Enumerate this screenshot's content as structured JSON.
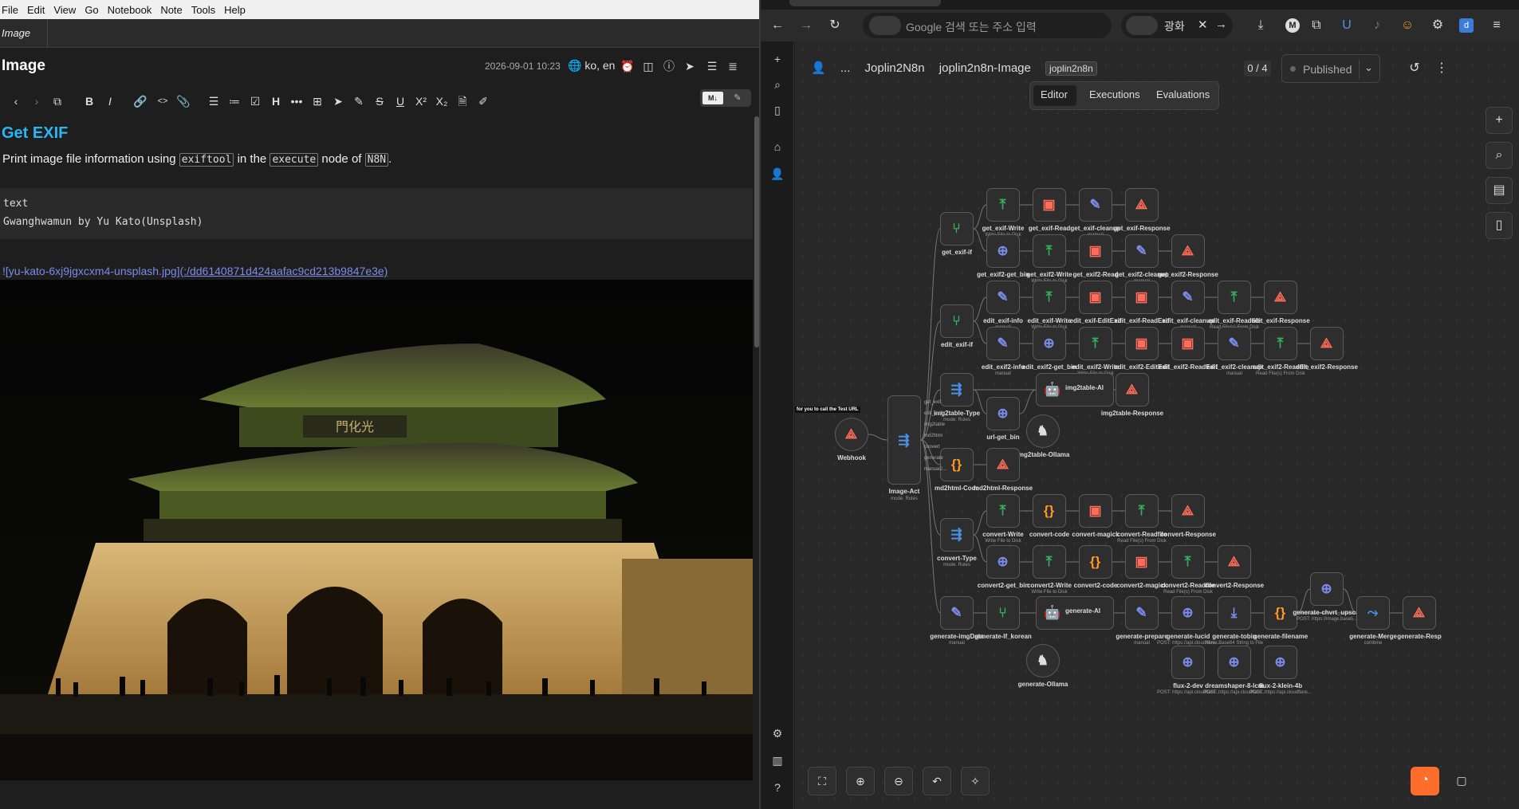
{
  "joplin": {
    "menu": [
      "File",
      "Edit",
      "View",
      "Go",
      "Notebook",
      "Note",
      "Tools",
      "Help"
    ],
    "tab_title": "Image",
    "note_title": "Image",
    "note_date": "2026-09-01 10:23",
    "note_lang": "ko, en",
    "md_toggle_label": "M↓",
    "heading": "Get EXIF",
    "para_prefix": "Print image file information using ",
    "code1": "exiftool",
    "para_mid": " in the ",
    "code2": "execute",
    "para_mid2": " node of ",
    "code3": "N8N",
    "para_end": ".",
    "code_block": "text\nGwanghwamun by Yu Kato(Unsplash)",
    "link_text": "![yu-kato-6xj9jgxcxm4-unsplash.jpg]",
    "link_url": "(:/dd6140871d424aafac9cd213b9847e3e)"
  },
  "browser": {
    "url_placeholder": "Google 검색 또는 주소 입력",
    "search_query": "광화",
    "breadcrumb": [
      "...",
      "Joplin2N8n",
      "joplin2n8n-Image"
    ],
    "tag": "joplin2n8n",
    "counter": "0 / 4",
    "published": "Published",
    "tabs": [
      "Editor",
      "Executions",
      "Evaluations"
    ]
  },
  "workflow": {
    "nodes": [
      {
        "id": "webhook",
        "label": "Webhook",
        "sub": "",
        "icon": "webhook-icon",
        "color": "#ff6d5a"
      },
      {
        "id": "image-act",
        "label": "Image-Act",
        "sub": "mode: Rules",
        "icon": "switch-icon",
        "color": "#4a90e2"
      },
      {
        "id": "get-exif-if",
        "label": "get_exif-if",
        "sub": "",
        "icon": "if-icon",
        "color": "#35b05c"
      },
      {
        "id": "get-exif-write",
        "label": "get_exif-Write",
        "sub": "Write File to Disk",
        "icon": "disk-icon",
        "color": "#35b05c"
      },
      {
        "id": "get-exif-read",
        "label": "get_exif-Read",
        "sub": "",
        "icon": "terminal-icon",
        "color": "#ff6d5a"
      },
      {
        "id": "get-exif-cleanup",
        "label": "get_exif-cleanup",
        "sub": "manual",
        "icon": "edit-icon",
        "color": "#7b8be8"
      },
      {
        "id": "get-exif-response",
        "label": "get_exif-Response",
        "sub": "",
        "icon": "webhook-icon",
        "color": "#ff6d5a"
      },
      {
        "id": "get-exif2-get-bin",
        "label": "get_exif2-get_bin",
        "sub": "",
        "icon": "globe-icon",
        "color": "#7b8be8"
      },
      {
        "id": "get-exif2-write",
        "label": "get_exif2-Write",
        "sub": "Write File to Disk",
        "icon": "disk-icon",
        "color": "#35b05c"
      },
      {
        "id": "get-exif2-read",
        "label": "get_exif2-Read",
        "sub": "",
        "icon": "terminal-icon",
        "color": "#ff6d5a"
      },
      {
        "id": "get-exif2-cleanup",
        "label": "get_exif2-cleanup",
        "sub": "manual",
        "icon": "edit-icon",
        "color": "#7b8be8"
      },
      {
        "id": "get-exif2-response",
        "label": "get_exif2-Response",
        "sub": "",
        "icon": "webhook-icon",
        "color": "#ff6d5a"
      },
      {
        "id": "edit-exif-if",
        "label": "edit_exif-if",
        "sub": "",
        "icon": "if-icon",
        "color": "#35b05c"
      },
      {
        "id": "edit-exif-info",
        "label": "edit_exif-info",
        "sub": "manual",
        "icon": "edit-icon",
        "color": "#7b8be8"
      },
      {
        "id": "edit-exif-write",
        "label": "edit_exif-Write",
        "sub": "Write File to Disk",
        "icon": "disk-icon",
        "color": "#35b05c"
      },
      {
        "id": "edit-exif-editexif",
        "label": "edit_exif-EditExif",
        "sub": "",
        "icon": "terminal-icon",
        "color": "#ff6d5a"
      },
      {
        "id": "edit-exif-readexif",
        "label": "edit_exif-ReadExif",
        "sub": "",
        "icon": "terminal-icon",
        "color": "#ff6d5a"
      },
      {
        "id": "edit-exif-cleanup",
        "label": "edit_exif-cleanup",
        "sub": "manual",
        "icon": "edit-icon",
        "color": "#7b8be8"
      },
      {
        "id": "edit-exif-readfile",
        "label": "edit_exif-Readfile",
        "sub": "Read File(s) From Disk",
        "icon": "disk-icon",
        "color": "#35b05c"
      },
      {
        "id": "edit-exif-response",
        "label": "edit_exif-Response",
        "sub": "",
        "icon": "webhook-icon",
        "color": "#ff6d5a"
      },
      {
        "id": "edit-exif2-info",
        "label": "edit_exif2-info",
        "sub": "manual",
        "icon": "edit-icon",
        "color": "#7b8be8"
      },
      {
        "id": "edit-exif2-get-bin",
        "label": "edit_exif2-get_bin",
        "sub": "",
        "icon": "globe-icon",
        "color": "#7b8be8"
      },
      {
        "id": "edit-exif2-write",
        "label": "edit_exif2-Write",
        "sub": "Write File to Disk",
        "icon": "disk-icon",
        "color": "#35b05c"
      },
      {
        "id": "edit-exif2-editexif",
        "label": "edit_exif2-EditExif",
        "sub": "",
        "icon": "terminal-icon",
        "color": "#ff6d5a"
      },
      {
        "id": "edit-exif2-readexif",
        "label": "edit_exif2-ReadExif",
        "sub": "",
        "icon": "terminal-icon",
        "color": "#ff6d5a"
      },
      {
        "id": "edit-exif2-cleanup",
        "label": "edit_exif2-cleanup",
        "sub": "manual",
        "icon": "edit-icon",
        "color": "#7b8be8"
      },
      {
        "id": "edit-exif2-readfile",
        "label": "edit_exif2-Readfile",
        "sub": "Read File(s) From Disk",
        "icon": "disk-icon",
        "color": "#35b05c"
      },
      {
        "id": "edit-exif2-response",
        "label": "edit_exif2-Response",
        "sub": "",
        "icon": "webhook-icon",
        "color": "#ff6d5a"
      },
      {
        "id": "img2table-type",
        "label": "img2table-Type",
        "sub": "mode: Rules",
        "icon": "switch-icon",
        "color": "#4a90e2"
      },
      {
        "id": "url-get-bin",
        "label": "url-get_bin",
        "sub": "",
        "icon": "globe-icon",
        "color": "#7b8be8"
      },
      {
        "id": "img2table-ai",
        "label": "img2table-AI",
        "sub": "",
        "icon": "robot-icon",
        "color": "#dddddd"
      },
      {
        "id": "img2table-ollama",
        "label": "img2table-Ollama",
        "sub": "",
        "icon": "llama-icon",
        "color": "#dddddd"
      },
      {
        "id": "img2table-response",
        "label": "img2table-Response",
        "sub": "",
        "icon": "webhook-icon",
        "color": "#ff6d5a"
      },
      {
        "id": "md2html-code",
        "label": "md2html-Code",
        "sub": "",
        "icon": "code-icon",
        "color": "#ff9922"
      },
      {
        "id": "md2html-response",
        "label": "md2html-Response",
        "sub": "",
        "icon": "webhook-icon",
        "color": "#ff6d5a"
      },
      {
        "id": "convert-type",
        "label": "convert-Type",
        "sub": "mode: Rules",
        "icon": "switch-icon",
        "color": "#4a90e2"
      },
      {
        "id": "convert-write",
        "label": "convert-Write",
        "sub": "Write File to Disk",
        "icon": "disk-icon",
        "color": "#35b05c"
      },
      {
        "id": "convert-code",
        "label": "convert-code",
        "sub": "",
        "icon": "code-icon",
        "color": "#ff9922"
      },
      {
        "id": "convert-magick",
        "label": "convert-magick",
        "sub": "",
        "icon": "terminal-icon",
        "color": "#ff6d5a"
      },
      {
        "id": "convert-readfile",
        "label": "convert-Readfile",
        "sub": "Read File(s) From Disk",
        "icon": "disk-icon",
        "color": "#35b05c"
      },
      {
        "id": "convert-response",
        "label": "convert-Response",
        "sub": "",
        "icon": "webhook-icon",
        "color": "#ff6d5a"
      },
      {
        "id": "convert2-get-bin",
        "label": "convert2-get_bin",
        "sub": "",
        "icon": "globe-icon",
        "color": "#7b8be8"
      },
      {
        "id": "convert2-write",
        "label": "convert2-Write",
        "sub": "Write File to Disk",
        "icon": "disk-icon",
        "color": "#35b05c"
      },
      {
        "id": "convert2-code",
        "label": "convert2-code",
        "sub": "",
        "icon": "code-icon",
        "color": "#ff9922"
      },
      {
        "id": "convert2-magick",
        "label": "convert2-magick",
        "sub": "",
        "icon": "terminal-icon",
        "color": "#ff6d5a"
      },
      {
        "id": "convert2-readfile",
        "label": "convert2-Readfile",
        "sub": "Read File(s) From Disk",
        "icon": "disk-icon",
        "color": "#35b05c"
      },
      {
        "id": "convert2-response",
        "label": "convert2-Response",
        "sub": "",
        "icon": "webhook-icon",
        "color": "#ff6d5a"
      },
      {
        "id": "generate-imgdata",
        "label": "generate-imgData",
        "sub": "manual",
        "icon": "edit-icon",
        "color": "#7b8be8"
      },
      {
        "id": "generate-if-korean",
        "label": "generate-If_korean",
        "sub": "",
        "icon": "if-icon",
        "color": "#35b05c"
      },
      {
        "id": "generate-ai",
        "label": "generate-AI",
        "sub": "",
        "icon": "robot-icon",
        "color": "#dddddd"
      },
      {
        "id": "generate-ollama",
        "label": "generate-Ollama",
        "sub": "",
        "icon": "llama-icon",
        "color": "#dddddd"
      },
      {
        "id": "generate-prepare",
        "label": "generate-prepare",
        "sub": "manual",
        "icon": "edit-icon",
        "color": "#7b8be8"
      },
      {
        "id": "generate-lucid",
        "label": "generate-lucid",
        "sub": "POST: https://api.cloudflare...",
        "icon": "globe-icon",
        "color": "#7b8be8"
      },
      {
        "id": "generate-tobin",
        "label": "generate-tobin",
        "sub": "Move Base64 String to File",
        "icon": "file-icon",
        "color": "#7b8be8"
      },
      {
        "id": "generate-filename",
        "label": "generate-filename",
        "sub": "",
        "icon": "code-icon",
        "color": "#ff9922"
      },
      {
        "id": "generate-chvrt-upscale",
        "label": "generate-chvrt_upscal",
        "sub": "POST: https://image.baseli...",
        "icon": "globe-icon",
        "color": "#7b8be8"
      },
      {
        "id": "generate-merge",
        "label": "generate-Merge",
        "sub": "combine",
        "icon": "merge-icon",
        "color": "#4a90e2"
      },
      {
        "id": "generate-response",
        "label": "generate-Resp",
        "sub": "",
        "icon": "webhook-icon",
        "color": "#ff6d5a"
      },
      {
        "id": "flux-2-dev",
        "label": "flux-2-dev",
        "sub": "POST: https://api.cloudflare...",
        "icon": "globe-icon",
        "color": "#7b8be8"
      },
      {
        "id": "dreamshaper-8-lcm",
        "label": "dreamshaper-8-lcm",
        "sub": "POST: https://api.cloudflare...",
        "icon": "globe-icon",
        "color": "#7b8be8"
      },
      {
        "id": "flux-2-klein-4b",
        "label": "flux-2-klein-4b",
        "sub": "POST: https://api.cloudflare...",
        "icon": "globe-icon",
        "color": "#7b8be8"
      }
    ],
    "webhook_tip": "for you to call the Test URL",
    "switch_outputs": [
      "get_exif",
      "edit_exif",
      "img2table",
      "md2html",
      "convert",
      "generate",
      "manual2..."
    ]
  }
}
